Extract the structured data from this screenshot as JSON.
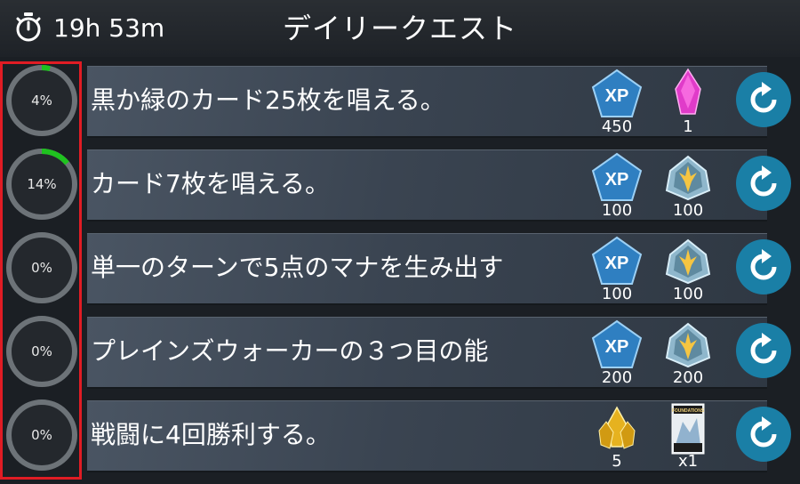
{
  "header": {
    "timer": "19h 53m",
    "title": "デイリークエスト"
  },
  "quests": [
    {
      "percent_label": "4%",
      "progress": 0.04,
      "text": "黒か緑のカード25枚を唱える。",
      "reward1": {
        "icon": "xp-icon",
        "label": "XP",
        "amount": "450"
      },
      "reward2": {
        "icon": "pink-gem-icon",
        "amount": "1"
      }
    },
    {
      "percent_label": "14%",
      "progress": 0.14,
      "text": "カード7枚を唱える。",
      "reward1": {
        "icon": "xp-icon",
        "label": "XP",
        "amount": "100"
      },
      "reward2": {
        "icon": "gold-emblem-icon",
        "amount": "100"
      }
    },
    {
      "percent_label": "0%",
      "progress": 0.0,
      "text": "単一のターンで5点のマナを生み出す",
      "reward1": {
        "icon": "xp-icon",
        "label": "XP",
        "amount": "100"
      },
      "reward2": {
        "icon": "gold-emblem-icon",
        "amount": "100"
      }
    },
    {
      "percent_label": "0%",
      "progress": 0.0,
      "text": "プレインズウォーカーの３つ目の能",
      "reward1": {
        "icon": "xp-icon",
        "label": "XP",
        "amount": "200"
      },
      "reward2": {
        "icon": "gold-emblem-icon",
        "amount": "200"
      }
    },
    {
      "percent_label": "0%",
      "progress": 0.0,
      "text": "戦闘に4回勝利する。",
      "reward1": {
        "icon": "gold-crystal-icon",
        "amount": "5"
      },
      "reward2": {
        "icon": "booster-pack-icon",
        "pack_label": "FOUNDATIONS",
        "amount": "x1"
      }
    }
  ],
  "colors": {
    "progress": "#1fc21f",
    "ring": "#6d7378",
    "xp": "#2f7fc1",
    "reroll": "#1a7fa6",
    "highlight": "#e01c24"
  }
}
